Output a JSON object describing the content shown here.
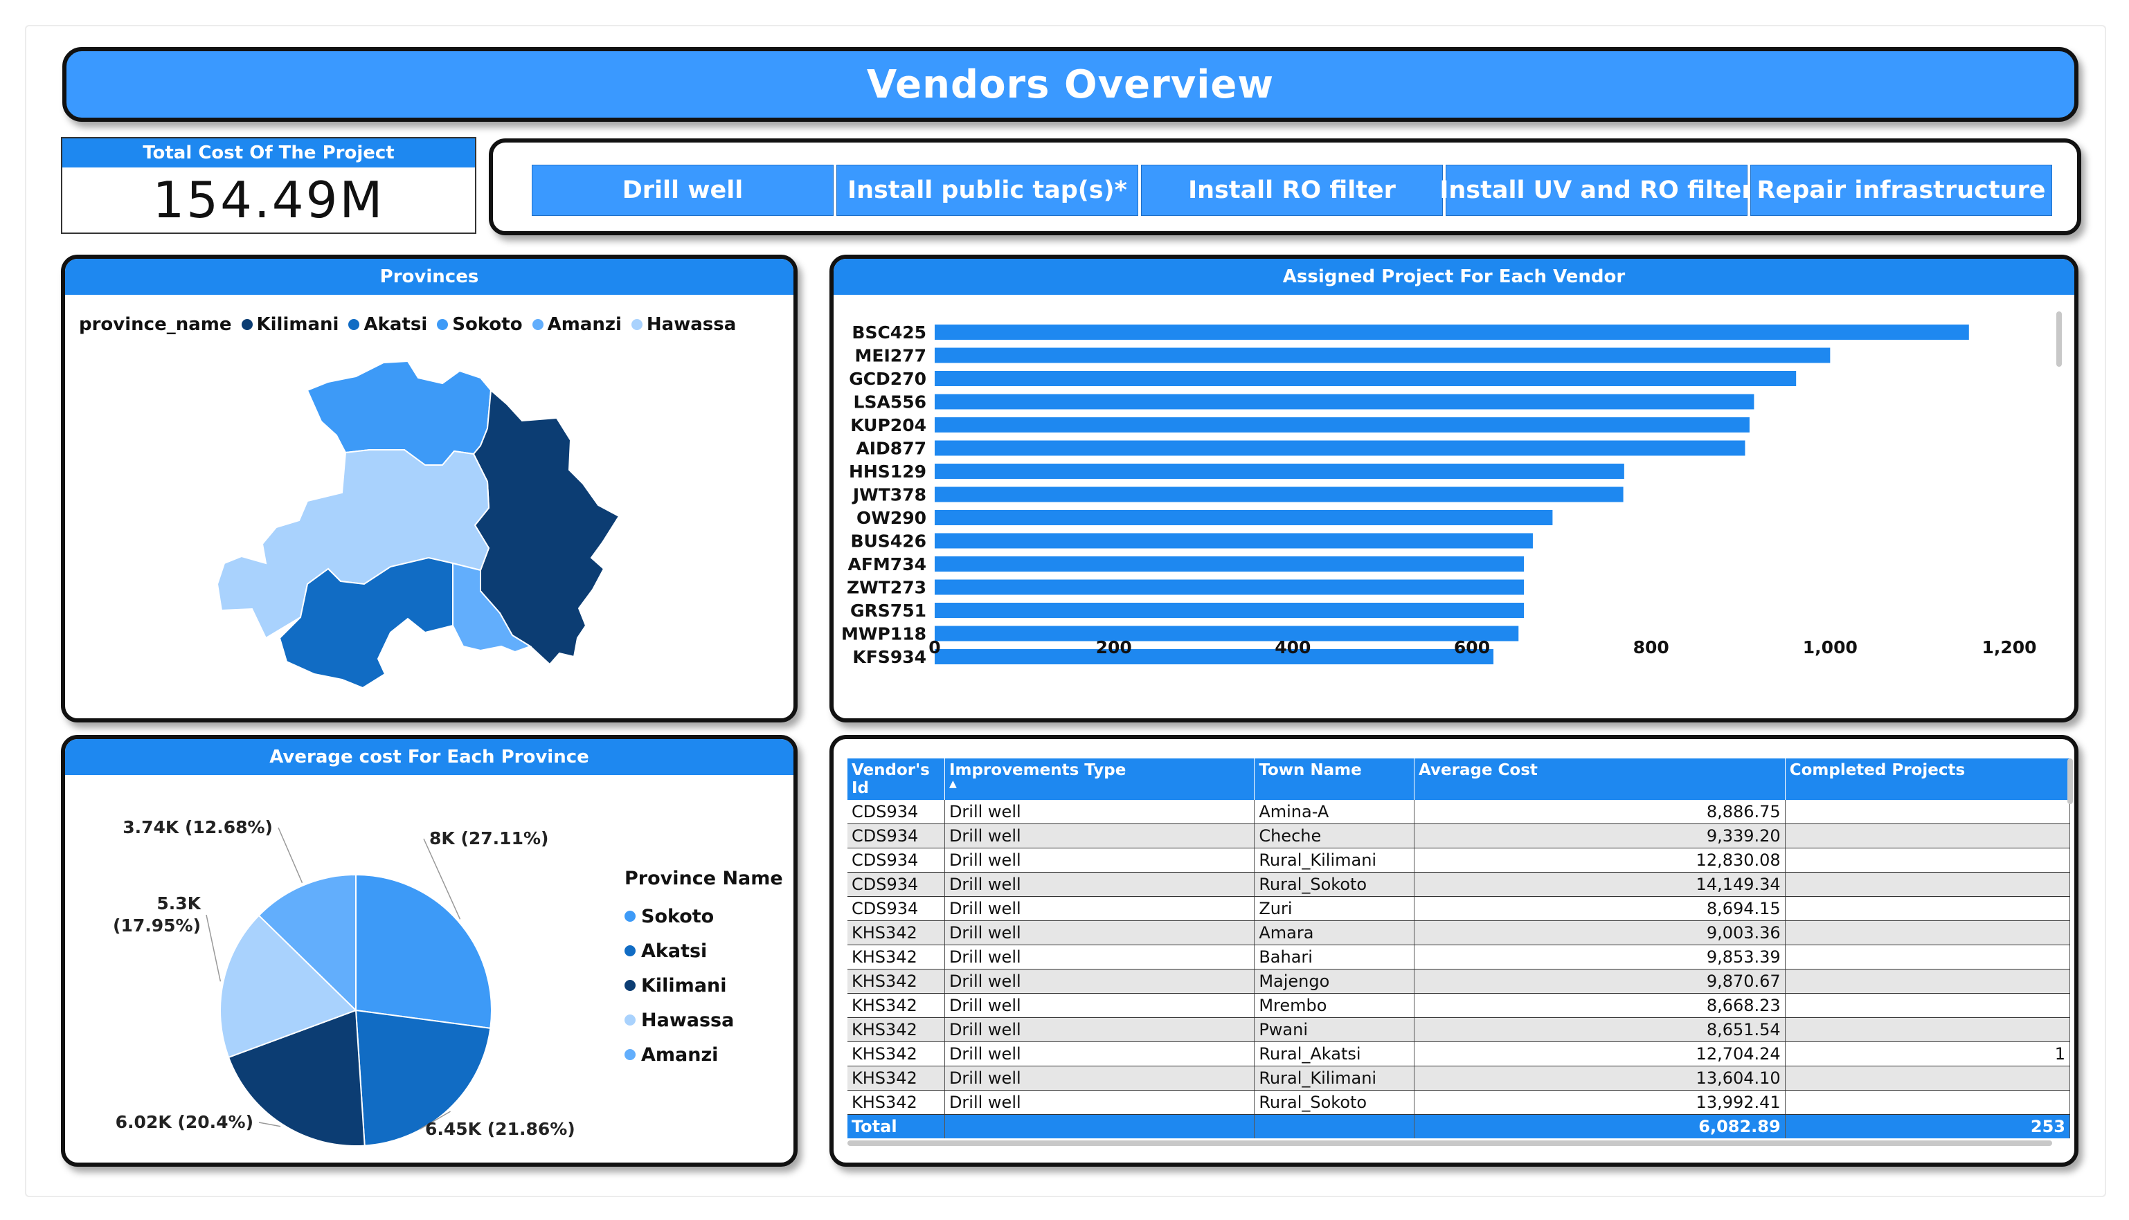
{
  "header": {
    "title": "Vendors Overview"
  },
  "kpi": {
    "label": "Total Cost Of The Project",
    "value": "154.49M"
  },
  "slicer": {
    "buttons": [
      "Drill well",
      "Install public tap(s)*",
      "Install RO filter",
      "Install UV and RO filter",
      "Repair infrastructure"
    ]
  },
  "colors": {
    "header_blue": "#3a99ff",
    "panel_head_blue": "#1e88f0",
    "bar_blue": "#1e88f0"
  },
  "provinces": {
    "title": "Provinces",
    "legend_title": "province_name",
    "legend": [
      {
        "name": "Kilimani",
        "color": "#0c3d73"
      },
      {
        "name": "Akatsi",
        "color": "#116cc4"
      },
      {
        "name": "Sokoto",
        "color": "#3d9af7"
      },
      {
        "name": "Amanzi",
        "color": "#62aefc"
      },
      {
        "name": "Hawassa",
        "color": "#a9d2fd"
      }
    ]
  },
  "bar_panel": {
    "title": "Assigned Project For Each Vendor"
  },
  "pie_panel": {
    "title": "Average cost For Each Province",
    "legend_title": "Province Name",
    "legend": [
      {
        "name": "Sokoto",
        "color": "#3d9af7"
      },
      {
        "name": "Akatsi",
        "color": "#116cc4"
      },
      {
        "name": "Kilimani",
        "color": "#0c3d73"
      },
      {
        "name": "Hawassa",
        "color": "#a9d2fd"
      },
      {
        "name": "Amanzi",
        "color": "#62aefc"
      }
    ]
  },
  "chart_data": [
    {
      "type": "bar",
      "orientation": "horizontal",
      "title": "Assigned Project For Each Vendor",
      "categories": [
        "BSC425",
        "MEI277",
        "GCD270",
        "LSA556",
        "KUP204",
        "AID877",
        "HHS129",
        "JWT378",
        "OW290",
        "BUS426",
        "AFM734",
        "ZWT273",
        "GRS751",
        "MWP118",
        "KFS934"
      ],
      "values": [
        1155,
        1000,
        962,
        915,
        910,
        905,
        770,
        769,
        690,
        668,
        658,
        658,
        658,
        652,
        624
      ],
      "xlim": [
        0,
        1200
      ],
      "ticks": [
        "0",
        "200",
        "400",
        "600",
        "800",
        "1,000",
        "1,200"
      ],
      "tick_values": [
        0,
        200,
        400,
        600,
        800,
        1000,
        1200
      ],
      "grid": false
    },
    {
      "type": "pie",
      "title": "Average cost For Each Province",
      "slices": [
        {
          "name": "Sokoto",
          "value": 8000,
          "label": "8K (27.11%)",
          "color": "#3d9af7"
        },
        {
          "name": "Akatsi",
          "value": 6450,
          "label": "6.45K (21.86%)",
          "color": "#116cc4"
        },
        {
          "name": "Kilimani",
          "value": 6020,
          "label": "6.02K (20.4%)",
          "color": "#0c3d73"
        },
        {
          "name": "Hawassa",
          "value": 5300,
          "label": "5.3K (17.95%)",
          "color": "#a9d2fd"
        },
        {
          "name": "Amanzi",
          "value": 3740,
          "label": "3.74K (12.68%)",
          "color": "#62aefc"
        }
      ],
      "legend_position": "right"
    },
    {
      "type": "table",
      "columns": [
        "Vendor's Id",
        "Improvements Type",
        "Town Name",
        "Average Cost",
        "Completed Projects"
      ],
      "rows": [
        [
          "CDS934",
          "Drill well",
          "Amina-A",
          "8,886.75",
          ""
        ],
        [
          "CDS934",
          "Drill well",
          "Cheche",
          "9,339.20",
          ""
        ],
        [
          "CDS934",
          "Drill well",
          "Rural_Kilimani",
          "12,830.08",
          ""
        ],
        [
          "CDS934",
          "Drill well",
          "Rural_Sokoto",
          "14,149.34",
          ""
        ],
        [
          "CDS934",
          "Drill well",
          "Zuri",
          "8,694.15",
          ""
        ],
        [
          "KHS342",
          "Drill well",
          "Amara",
          "9,003.36",
          ""
        ],
        [
          "KHS342",
          "Drill well",
          "Bahari",
          "9,853.39",
          ""
        ],
        [
          "KHS342",
          "Drill well",
          "Majengo",
          "9,870.67",
          ""
        ],
        [
          "KHS342",
          "Drill well",
          "Mrembo",
          "8,668.23",
          ""
        ],
        [
          "KHS342",
          "Drill well",
          "Pwani",
          "8,651.54",
          ""
        ],
        [
          "KHS342",
          "Drill well",
          "Rural_Akatsi",
          "12,704.24",
          "1"
        ],
        [
          "KHS342",
          "Drill well",
          "Rural_Kilimani",
          "13,604.10",
          ""
        ],
        [
          "KHS342",
          "Drill well",
          "Rural_Sokoto",
          "13,992.41",
          ""
        ]
      ],
      "total": [
        "Total",
        "",
        "",
        "6,082.89",
        "253"
      ]
    }
  ]
}
